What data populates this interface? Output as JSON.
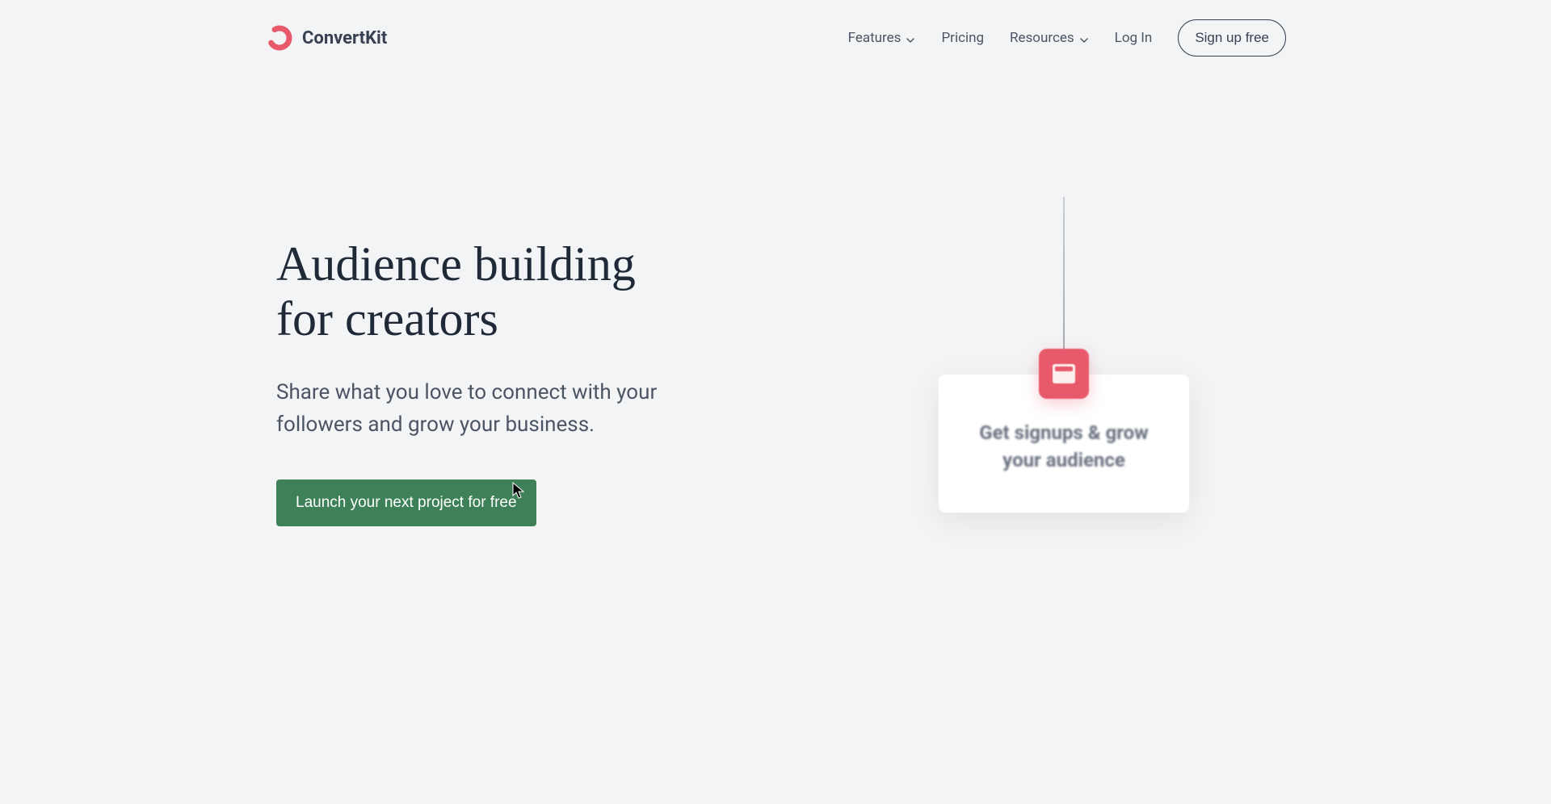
{
  "brand": {
    "name": "ConvertKit"
  },
  "nav": {
    "features": "Features",
    "pricing": "Pricing",
    "resources": "Resources",
    "login": "Log In",
    "signup": "Sign up free"
  },
  "hero": {
    "title_line1": "Audience building",
    "title_line2": "for creators",
    "subtitle": "Share what you love to connect with your followers and grow your business.",
    "cta": "Launch your next project for free"
  },
  "card": {
    "text_line1": "Get signups & grow",
    "text_line2": "your audience"
  }
}
